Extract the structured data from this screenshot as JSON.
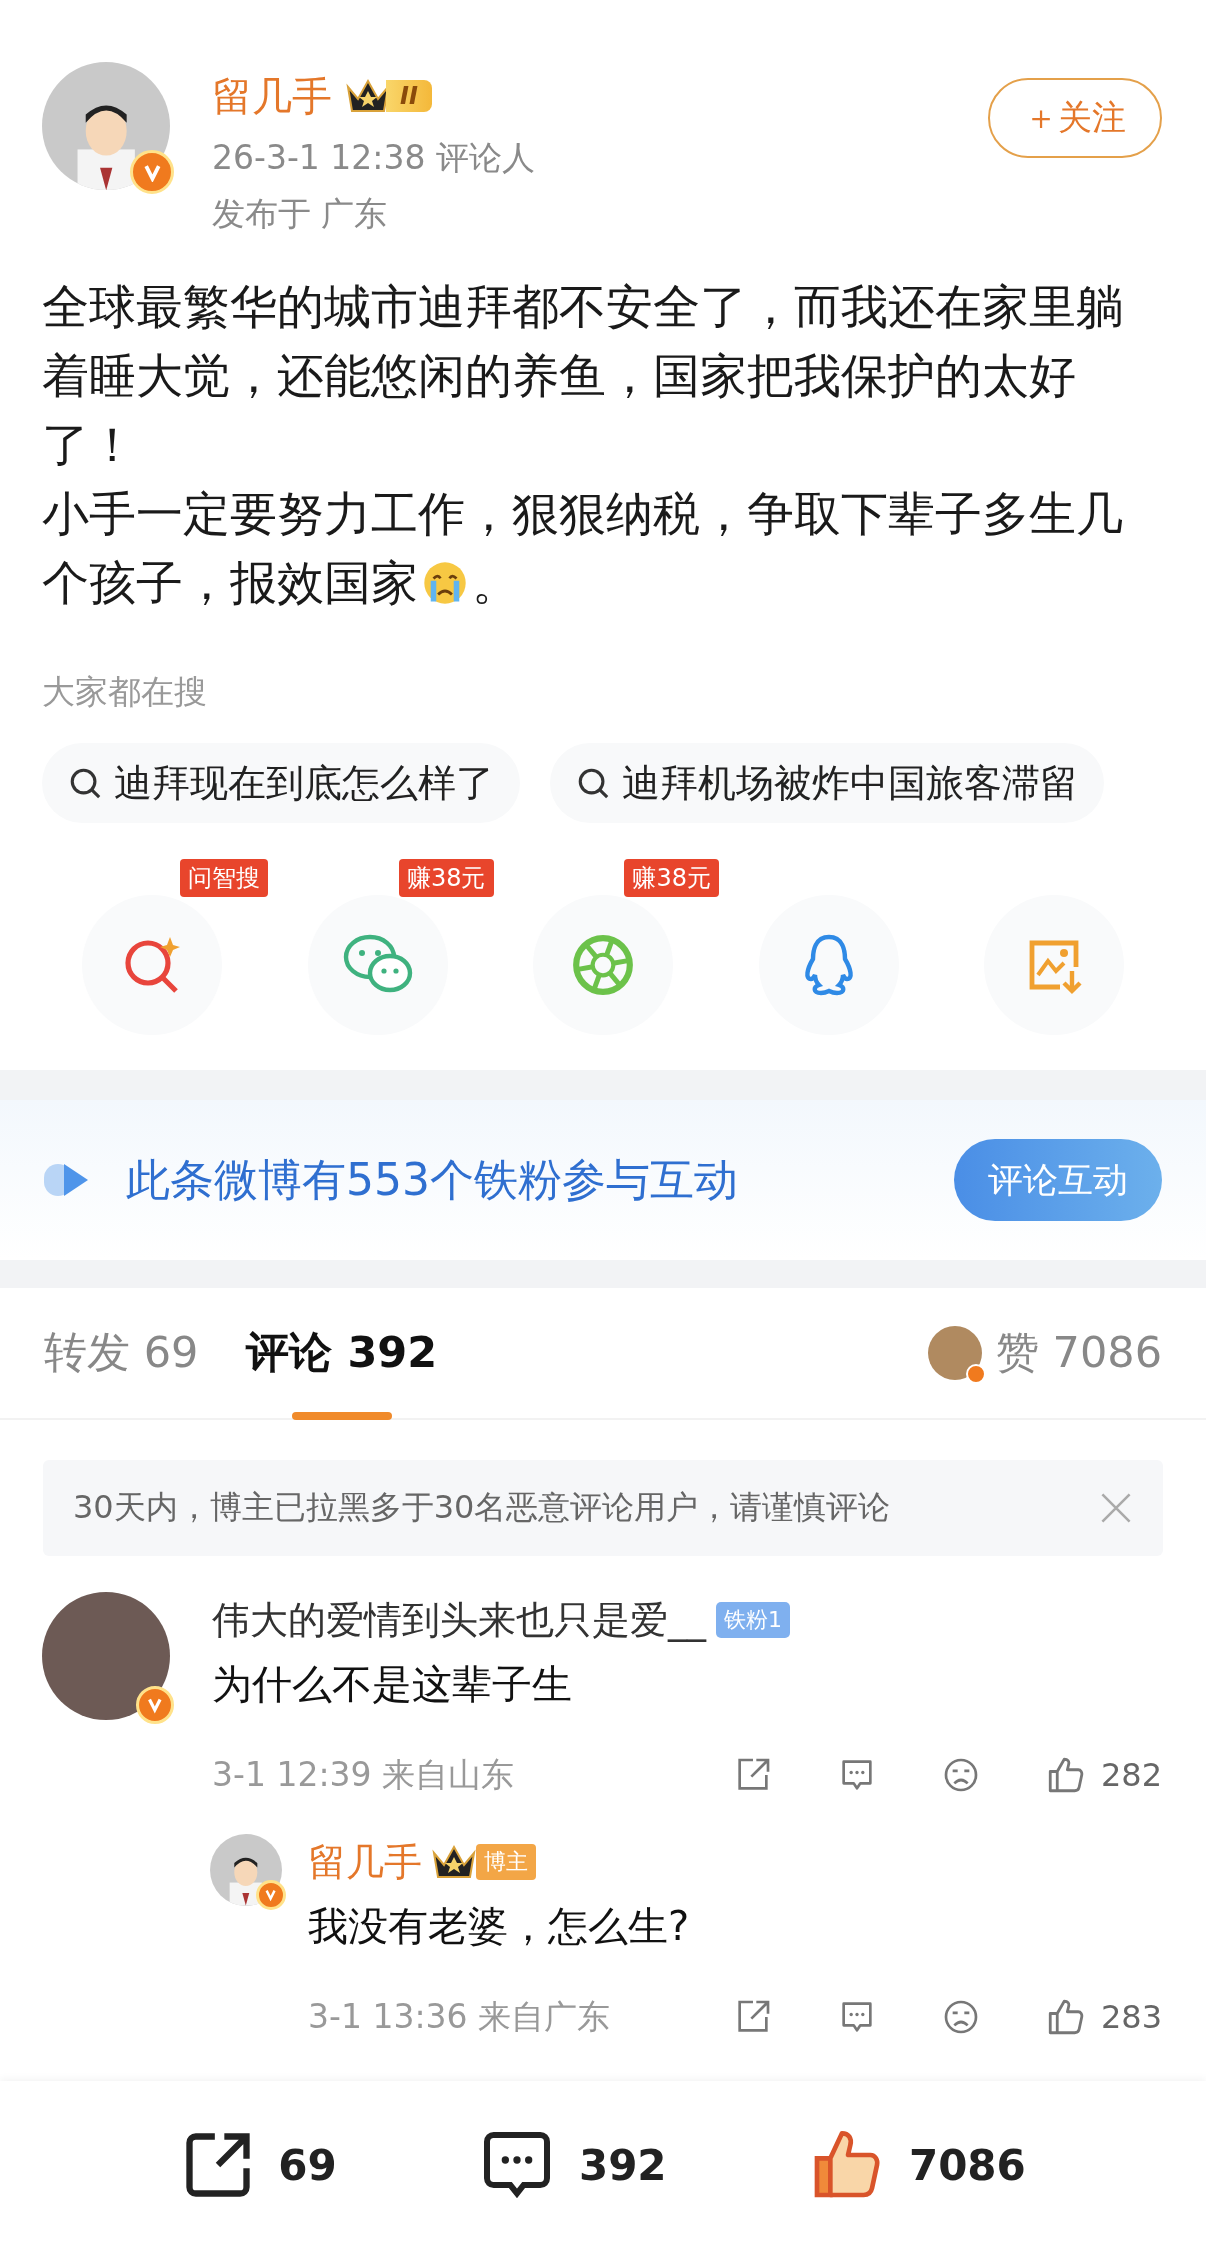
{
  "post": {
    "author": {
      "name": "留几手",
      "level": "II",
      "verified": true
    },
    "time": "26-3-1 12:38",
    "source": "评论人",
    "location": "发布于 广东",
    "follow_label": "＋关注",
    "lines": [
      {
        "kind": "plain",
        "text": "全球最繁华的城市迪拜都不安全了，而我还在家里躺"
      },
      {
        "kind": "plain",
        "text": "着睡大觉，还能悠闲的养鱼，国家把我保护的太好"
      },
      {
        "kind": "plain",
        "text": "了！"
      },
      {
        "kind": "plain",
        "text": "小手一定要努力工作，狠狠纳税，争取下辈子多生几"
      },
      {
        "kind": "crying-emoji",
        "text": "个孩子，报效国家",
        "text_after": "。"
      }
    ]
  },
  "hot_search": {
    "title": "大家都在搜",
    "items": [
      "迪拜现在到底怎么样了",
      "迪拜机场被炸中国旅客滞留"
    ]
  },
  "share": [
    {
      "kind": "ai-search",
      "badge": "问智搜"
    },
    {
      "kind": "wechat",
      "badge": "赚38元"
    },
    {
      "kind": "moments",
      "badge": "赚38元"
    },
    {
      "kind": "qq"
    },
    {
      "kind": "save-image"
    }
  ],
  "fans_banner": {
    "text": "此条微博有553个铁粉参与互动",
    "button": "评论互动"
  },
  "tabs": [
    {
      "label": "转发",
      "count": "69",
      "selected": false
    },
    {
      "label": "评论",
      "count": "392",
      "selected": true
    }
  ],
  "likes": {
    "label": "赞",
    "count": "7086"
  },
  "notice": "30天内，博主已拉黑多于30名恶意评论用户，请谨慎评论",
  "comments": [
    {
      "user": "伟大的爱情到头来也只是爱__",
      "verified": true,
      "badge": {
        "kind": "fan",
        "label": "铁粉1"
      },
      "text": "为什么不是这辈子生",
      "time": "3-1 12:39",
      "location": "来自山东",
      "likes": "282",
      "replies": [
        {
          "user": "留几手",
          "verified": true,
          "badge": {
            "kind": "author",
            "label": "博主"
          },
          "text": "我没有老婆，怎么生?",
          "time": "3-1 13:36",
          "location": "来自广东",
          "likes": "283"
        }
      ]
    }
  ],
  "bottom_bar": [
    {
      "kind": "repost",
      "count": "69"
    },
    {
      "kind": "comment",
      "count": "392"
    },
    {
      "kind": "like",
      "count": "7086"
    }
  ]
}
